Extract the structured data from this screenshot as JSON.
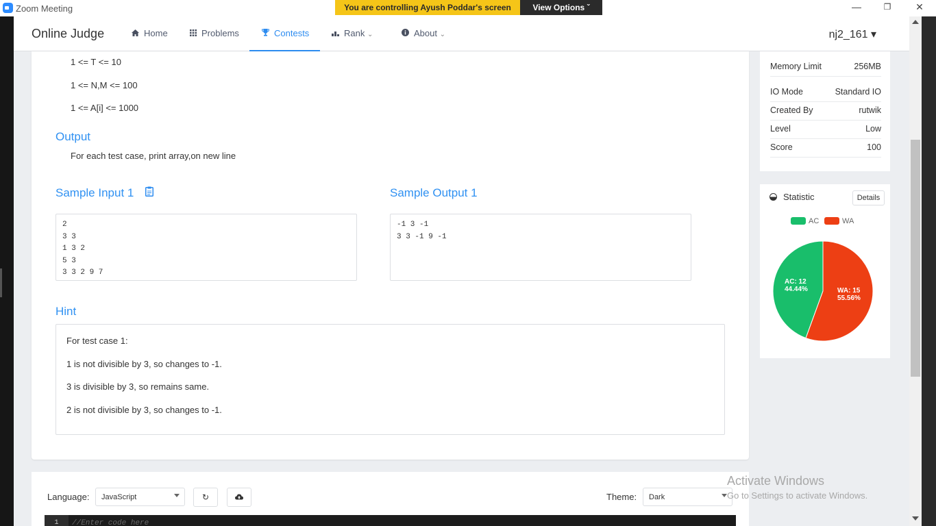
{
  "zoom": {
    "title": "Zoom Meeting",
    "banner": "You are controlling Ayush Poddar's screen",
    "view_options": "View Options ˇ",
    "minimize": "—",
    "restore": "❐",
    "close": "✕"
  },
  "nav": {
    "brand": "Online Judge",
    "items": [
      {
        "label": "Home",
        "icon": "home-icon"
      },
      {
        "label": "Problems",
        "icon": "grid-icon"
      },
      {
        "label": "Contests",
        "icon": "trophy-icon"
      },
      {
        "label": "Rank",
        "icon": "bar-chart-icon"
      },
      {
        "label": "About",
        "icon": "info-icon"
      }
    ],
    "active": "Contests",
    "user": "nj2_161 ▾",
    "accent": "#2d8cf0"
  },
  "problem": {
    "constraints": [
      "1 <= T <= 10",
      "1 <= N,M <= 100",
      "1 <= A[i] <= 1000"
    ],
    "output_heading": "Output",
    "output_text": "For each test case, print array,on new line",
    "sample_input_heading": "Sample Input 1",
    "sample_output_heading": "Sample Output 1",
    "sample_input_lines": [
      "2",
      "3 3",
      "1 3 2",
      "5 3",
      "3 3 2 9 7"
    ],
    "sample_output_lines": [
      "-1 3 -1",
      "3 3 -1 9 -1"
    ],
    "hint_heading": "Hint",
    "hint_lines": [
      "For test case 1:",
      "1 is not divisible by 3, so changes to -1.",
      "3 is divisible by 3, so remains same.",
      "2 is not divisible by 3, so changes to -1."
    ]
  },
  "info": {
    "rows": [
      {
        "key": "Memory Limit",
        "value": "256MB"
      },
      {
        "key": "IO Mode",
        "value": "Standard IO"
      },
      {
        "key": "Created By",
        "value": "rutwik"
      },
      {
        "key": "Level",
        "value": "Low"
      },
      {
        "key": "Score",
        "value": "100"
      }
    ]
  },
  "statistic": {
    "title": "Statistic",
    "details_label": "Details",
    "legend": [
      {
        "name": "AC",
        "color": "#19be6b"
      },
      {
        "name": "WA",
        "color": "#ed3f14"
      }
    ],
    "labels": {
      "ac_count": "AC: 12",
      "ac_pct": "44.44%",
      "wa_count": "WA: 15",
      "wa_pct": "55.56%"
    }
  },
  "chart_data": {
    "type": "pie",
    "categories": [
      "AC",
      "WA"
    ],
    "values": [
      12,
      15
    ],
    "percentages": [
      44.44,
      55.56
    ],
    "colors": [
      "#19be6b",
      "#ed3f14"
    ]
  },
  "editor": {
    "language_label": "Language:",
    "language_value": "JavaScript",
    "theme_label": "Theme:",
    "theme_value": "Dark",
    "line_number": "1",
    "code_placeholder": "//Enter code here"
  },
  "watermark": {
    "line1": "Activate Windows",
    "line2": "Go to Settings to activate Windows."
  }
}
